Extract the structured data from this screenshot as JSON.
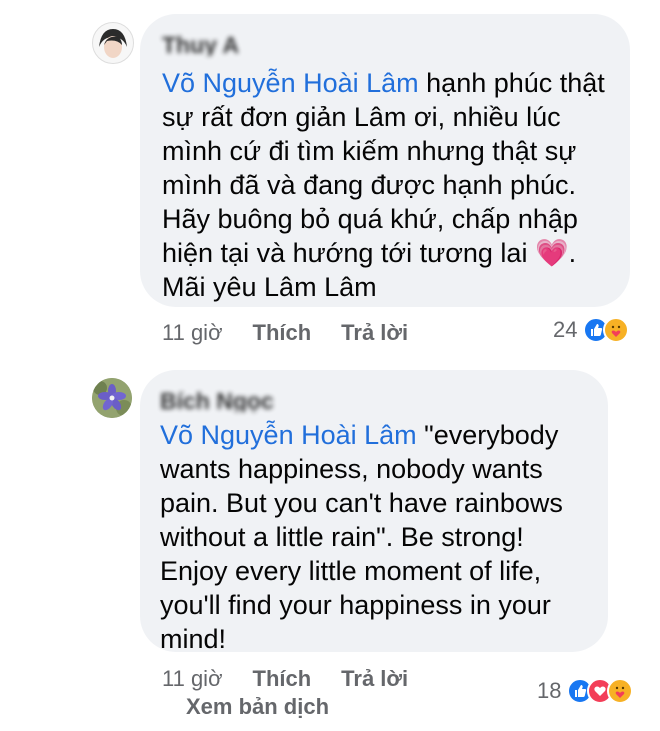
{
  "comments": [
    {
      "author": "Thuy A",
      "mention": "Võ Nguyễn Hoài Lâm",
      "text": " hạnh phúc thật sự rất đơn giản Lâm ơi, nhiều lúc mình cứ đi tìm kiếm nhưng thật sự mình đã và  đang được hạnh phúc. Hãy buông bỏ quá khứ, chấp nhập hiện tại và hướng tới tương lai ",
      "emoji": "💗",
      "text_end": ". Mãi yêu Lâm Lâm",
      "time": "11 giờ",
      "like": "Thích",
      "reply": "Trả lời",
      "reaction_count": "24",
      "reactions": [
        "like-icon",
        "care-icon"
      ]
    },
    {
      "author": "Bích Ngọc",
      "mention": "Võ Nguyễn Hoài Lâm",
      "text": " \"everybody wants happiness, nobody wants pain. But you can't have rainbows without a little rain\". Be strong! Enjoy every little moment of life, you'll find your happiness in your mind!",
      "time": "11 giờ",
      "like": "Thích",
      "reply": "Trả lời",
      "reaction_count": "18",
      "reactions": [
        "like-icon",
        "love-icon",
        "care-icon"
      ],
      "translate": "Xem bản dịch"
    }
  ],
  "colors": {
    "bubble": "#f0f2f5",
    "mention": "#216fdb",
    "meta": "#65676b",
    "like": "#1877f2",
    "love": "#f33e58",
    "care": "#f7b125"
  }
}
